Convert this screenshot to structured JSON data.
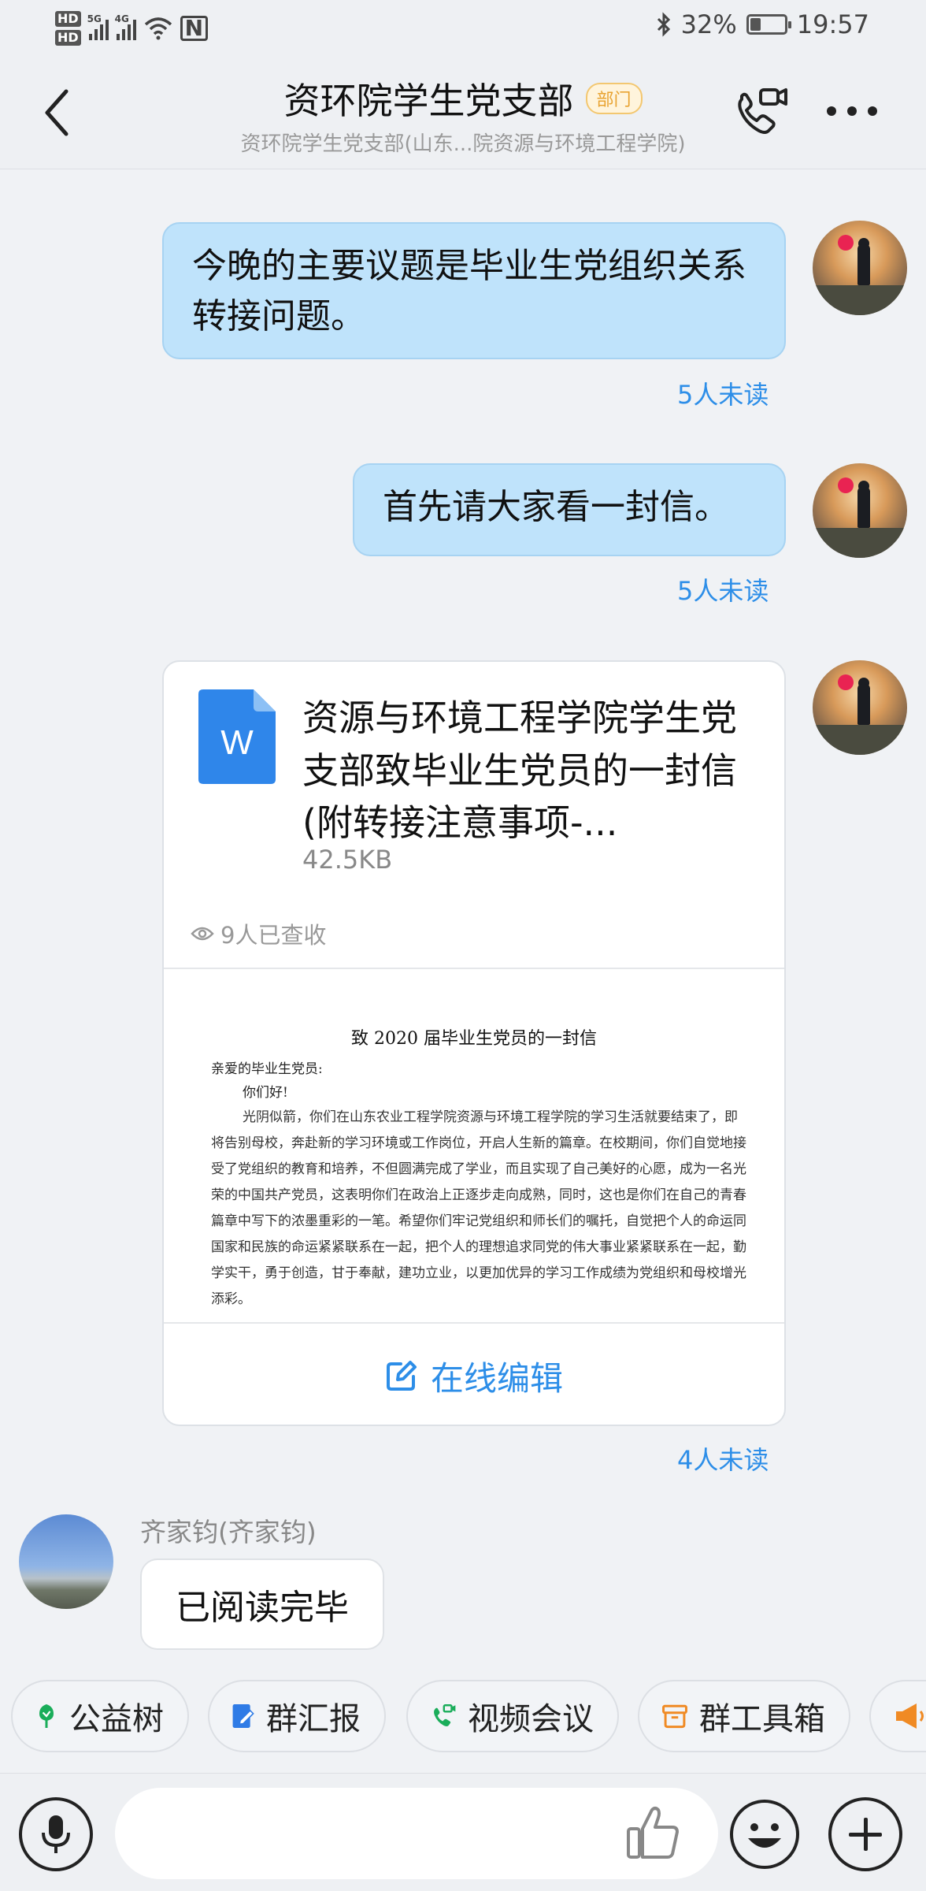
{
  "status_bar": {
    "hd1": "HD",
    "hd2": "HD",
    "net1": "5G",
    "net2": "4G",
    "nfc": "N",
    "battery": "32%",
    "battery_level": 0.32,
    "time": "19:57"
  },
  "header": {
    "title": "资环院学生党支部",
    "badge": "部门",
    "subtitle": "资环院学生党支部(山东...院资源与环境工程学院)"
  },
  "messages": [
    {
      "from": "self",
      "text": "今晚的主要议题是毕业生党组织关系转接问题。",
      "unread": "5人未读"
    },
    {
      "from": "self",
      "text": "首先请大家看一封信。",
      "unread": "5人未读"
    }
  ],
  "file_message": {
    "icon_letter": "W",
    "file_name": "资源与环境工程学院学生党支部致毕业生党员的一封信(附转接注意事项-...",
    "file_size": "42.5KB",
    "viewed": "9人已查收",
    "unread": "4人未读",
    "edit_label": "在线编辑",
    "preview": {
      "title": "致 2020 届毕业生党员的一封信",
      "salutation": "亲爱的毕业生党员:",
      "greeting": "你们好!",
      "body": "光阴似箭，你们在山东农业工程学院资源与环境工程学院的学习生活就要结束了，即将告别母校，奔赴新的学习环境或工作岗位，开启人生新的篇章。在校期间，你们自觉地接受了党组织的教育和培养，不但圆满完成了学业，而且实现了自己美好的心愿，成为一名光荣的中国共产党员，这表明你们在政治上正逐步走向成熟，同时，这也是你们在自己的青春篇章中写下的浓墨重彩的一笔。希望你们牢记党组织和师长们的嘱托，自觉把个人的命运同国家和民族的命运紧紧联系在一起，把个人的理想追求同党的伟大事业紧紧联系在一起，勤学实干，勇于创造，甘于奉献，建功立业，以更加优异的学习工作成绩为党组织和母校增光添彩。"
    }
  },
  "reply": {
    "sender": "齐家钧(齐家钧)",
    "text": "已阅读完毕"
  },
  "quick_actions": [
    {
      "label": "公益树",
      "icon": "tree-icon",
      "color": "#1aad5a"
    },
    {
      "label": "群汇报",
      "icon": "report-icon",
      "color": "#2f7be6"
    },
    {
      "label": "视频会议",
      "icon": "video-call-icon",
      "color": "#1aad5a"
    },
    {
      "label": "群工具箱",
      "icon": "toolbox-icon",
      "color": "#f08a24"
    },
    {
      "label": "",
      "icon": "megaphone-icon",
      "color": "#f08a24"
    }
  ],
  "input": {
    "placeholder": ""
  },
  "colors": {
    "accent": "#2d8ee8",
    "self_bubble": "#bfe3fb",
    "background": "#f0f2f5"
  }
}
